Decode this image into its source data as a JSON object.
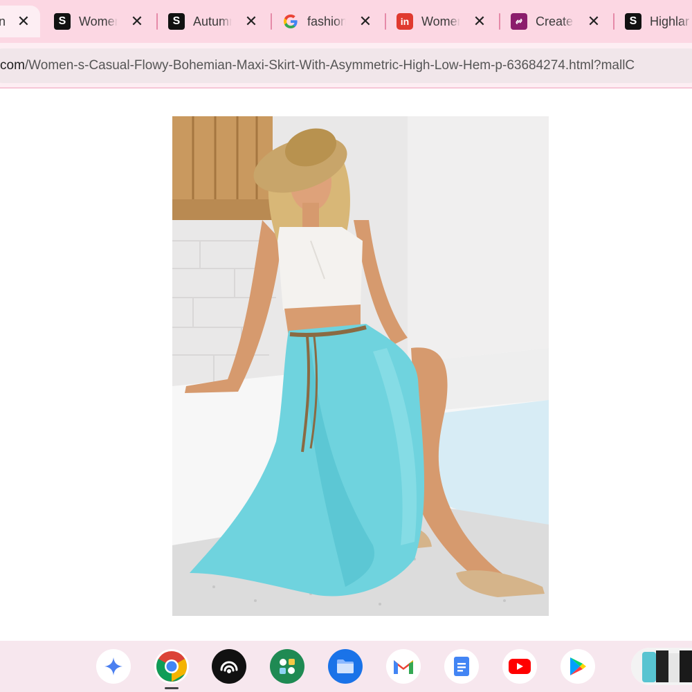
{
  "browser": {
    "tabs": [
      {
        "title": "n",
        "favicon": "none",
        "active": true
      },
      {
        "title": "Women",
        "favicon": "shein-s-icon"
      },
      {
        "title": "Autumn",
        "favicon": "shein-s-icon"
      },
      {
        "title": "fashion",
        "favicon": "google-g-icon"
      },
      {
        "title": "Women",
        "favicon": "in-icon"
      },
      {
        "title": "Create",
        "favicon": "link-icon"
      },
      {
        "title": "Highlar",
        "favicon": "shein-s-icon"
      }
    ],
    "close_glyph": "✕",
    "address": {
      "host": "com",
      "path": "/Women-s-Casual-Flowy-Bohemian-Maxi-Skirt-With-Asymmetric-High-Low-Hem-p-63684274.html?mallC"
    }
  },
  "colors": {
    "tabstrip": "#fcd7e3",
    "active_tab": "#fdeef3",
    "shelf": "#f7e7ee",
    "skirt": "#6fd3de"
  },
  "shelf": {
    "apps": [
      {
        "name": "assistant-icon"
      },
      {
        "name": "chrome-icon",
        "running": true
      },
      {
        "name": "podcast-icon"
      },
      {
        "name": "apps-launcher-icon"
      },
      {
        "name": "files-icon"
      },
      {
        "name": "gmail-icon"
      },
      {
        "name": "docs-icon"
      },
      {
        "name": "youtube-icon"
      },
      {
        "name": "play-store-icon"
      }
    ]
  }
}
